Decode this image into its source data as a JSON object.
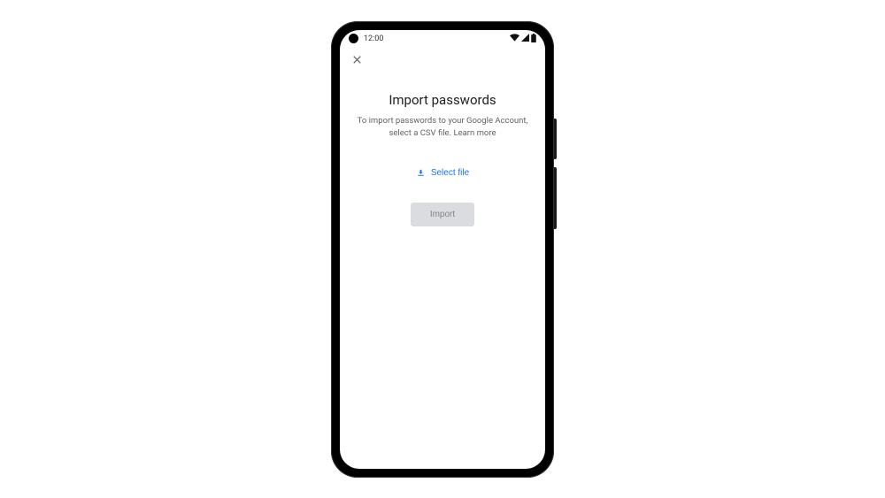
{
  "status": {
    "time": "12:00"
  },
  "page": {
    "title": "Import passwords",
    "subtitle_line1": "To import passwords to your Google Account,",
    "subtitle_line2": "select a CSV file.",
    "learn_more": "Learn more"
  },
  "actions": {
    "select_file": "Select file",
    "import": "Import"
  }
}
